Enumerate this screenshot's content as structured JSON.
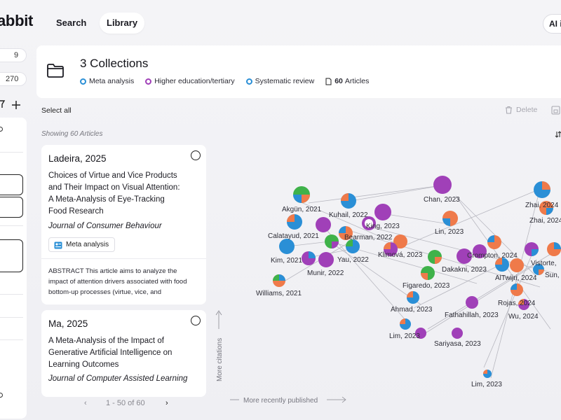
{
  "header": {
    "logo_text": "abbit",
    "nav": [
      {
        "label": "Search",
        "active": false
      },
      {
        "label": "Library",
        "active": true
      }
    ],
    "ai_button_label": "AI i"
  },
  "sidebar": {
    "count_a": "9",
    "count_b": "270",
    "filter_icon": "filter-icon",
    "add_icon": "plus-icon"
  },
  "collection": {
    "title": "3 Collections",
    "tags": [
      {
        "label": "Meta analysis",
        "color": "#2a8fd6"
      },
      {
        "label": "Higher education/tertiary",
        "color": "#a040b8"
      },
      {
        "label": "Systematic review",
        "color": "#2a8fd6"
      }
    ],
    "article_count": "60",
    "article_word": "Articles"
  },
  "toolbar": {
    "select_all": "Select all",
    "delete": "Delete",
    "showing": "Showing 60 Articles"
  },
  "articles": [
    {
      "author_year": "Ladeira, 2025",
      "title": "Choices of Virtue and Vice Products and Their Impact on Visual Attention: A Meta-Analysis of Eye-Tracking Food Research",
      "journal": "Journal of Consumer Behaviour",
      "tag": "Meta analysis",
      "abstract": "ABSTRACT This article aims to analyze the impact of attention drivers associated with food bottom-up processes (virtue, vice, and"
    },
    {
      "author_year": "Ma, 2025",
      "title": "A Meta-Analysis of the Impact of Generative Artificial Intelligence on Learning Outcomes",
      "journal": "Journal of Computer Assisted Learning"
    }
  ],
  "pagination": {
    "prev": "‹",
    "label": "1 - 50 of 60",
    "next": "›"
  },
  "graph": {
    "y_axis_label": "More citations",
    "x_axis_label": "More recently published",
    "colors": {
      "blue": "#2a8fd6",
      "purple": "#a040b8",
      "orange": "#ef7a4a",
      "green": "#3fb24a"
    }
  }
}
